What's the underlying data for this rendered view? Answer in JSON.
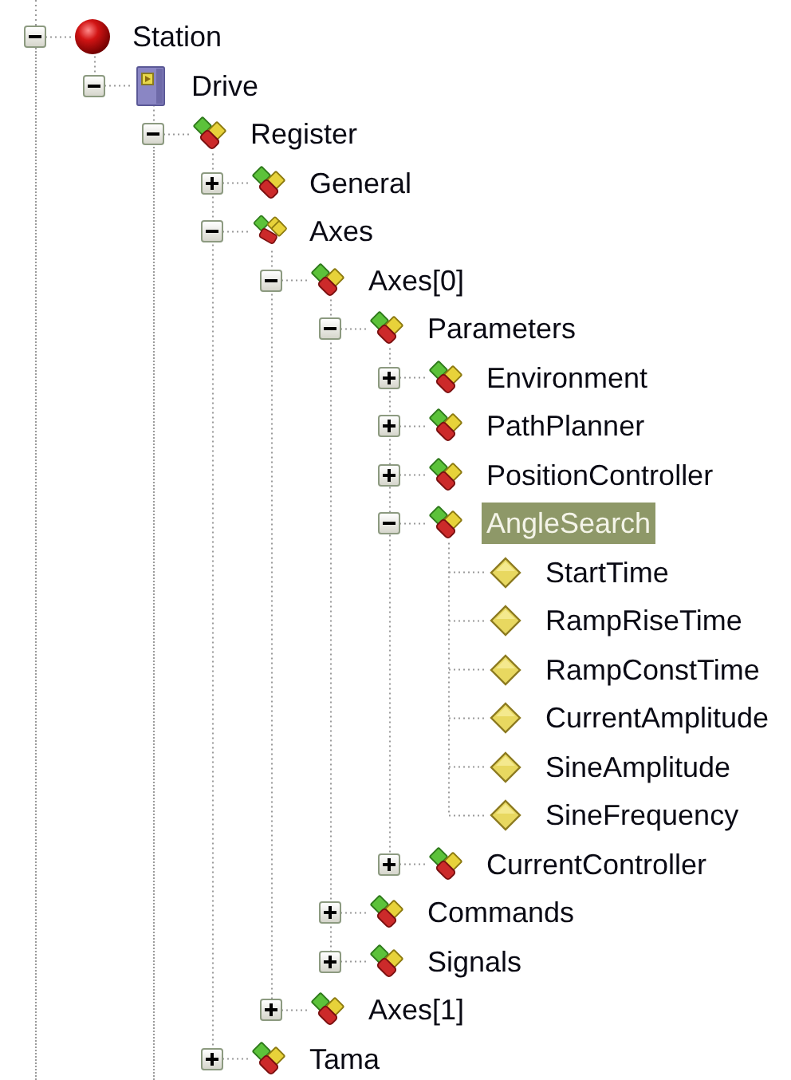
{
  "tree": [
    {
      "label": "Station",
      "kind": "ball",
      "expanded": true,
      "selected": false,
      "continues": true,
      "children": [
        {
          "label": "Drive",
          "kind": "drive",
          "expanded": true,
          "selected": false,
          "children": [
            {
              "label": "Register",
              "kind": "group",
              "expanded": true,
              "selected": false,
              "continues": true,
              "children": [
                {
                  "label": "General",
                  "kind": "group",
                  "expanded": false,
                  "selected": false
                },
                {
                  "label": "Axes",
                  "kind": "group-multi",
                  "expanded": true,
                  "selected": false,
                  "children": [
                    {
                      "label": "Axes[0]",
                      "kind": "group",
                      "expanded": true,
                      "selected": false,
                      "children": [
                        {
                          "label": "Parameters",
                          "kind": "group",
                          "expanded": true,
                          "selected": false,
                          "children": [
                            {
                              "label": "Environment",
                              "kind": "group",
                              "expanded": false,
                              "selected": false
                            },
                            {
                              "label": "PathPlanner",
                              "kind": "group",
                              "expanded": false,
                              "selected": false
                            },
                            {
                              "label": "PositionController",
                              "kind": "group",
                              "expanded": false,
                              "selected": false
                            },
                            {
                              "label": "AngleSearch",
                              "kind": "group",
                              "expanded": true,
                              "selected": true,
                              "children": [
                                {
                                  "label": "StartTime",
                                  "kind": "parameter",
                                  "selected": false
                                },
                                {
                                  "label": "RampRiseTime",
                                  "kind": "parameter",
                                  "selected": false
                                },
                                {
                                  "label": "RampConstTime",
                                  "kind": "parameter",
                                  "selected": false
                                },
                                {
                                  "label": "CurrentAmplitude",
                                  "kind": "parameter",
                                  "selected": false
                                },
                                {
                                  "label": "SineAmplitude",
                                  "kind": "parameter",
                                  "selected": false
                                },
                                {
                                  "label": "SineFrequency",
                                  "kind": "parameter",
                                  "selected": false
                                }
                              ]
                            },
                            {
                              "label": "CurrentController",
                              "kind": "group",
                              "expanded": false,
                              "selected": false
                            }
                          ]
                        },
                        {
                          "label": "Commands",
                          "kind": "group",
                          "expanded": false,
                          "selected": false
                        },
                        {
                          "label": "Signals",
                          "kind": "group",
                          "expanded": false,
                          "selected": false
                        }
                      ]
                    },
                    {
                      "label": "Axes[1]",
                      "kind": "group",
                      "expanded": false,
                      "selected": false
                    }
                  ]
                },
                {
                  "label": "Tama",
                  "kind": "group",
                  "expanded": false,
                  "selected": false
                }
              ]
            }
          ]
        }
      ]
    }
  ]
}
